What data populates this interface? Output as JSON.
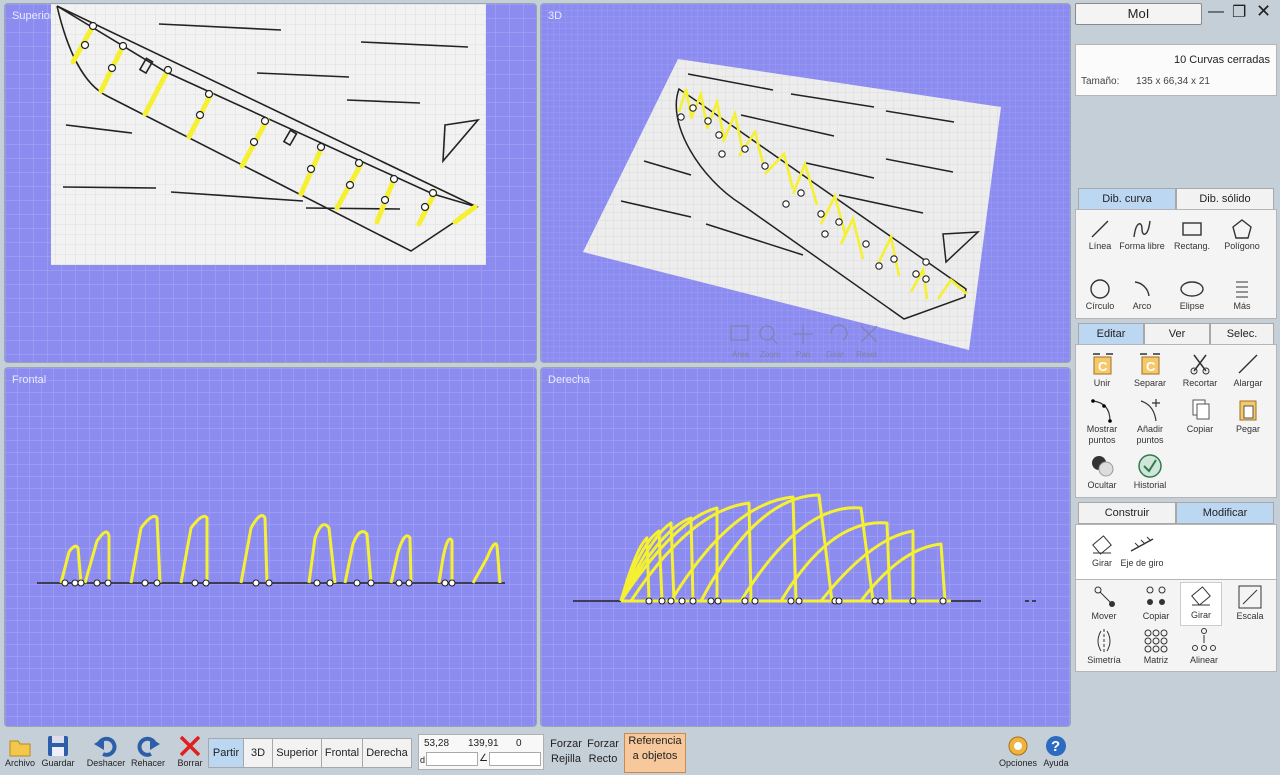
{
  "viewports": {
    "top": {
      "title": "Superior"
    },
    "perspective": {
      "title": "3D"
    },
    "front": {
      "title": "Frontal"
    },
    "right": {
      "title": "Derecha"
    }
  },
  "nav_tools": [
    "Área",
    "Zoom",
    "Pan",
    "Girar",
    "Reset"
  ],
  "app_title": "MoI",
  "properties": {
    "count": "10 Curvas cerradas",
    "size_label": "Tamaño:",
    "size_value": "135 x 66,34 x 21"
  },
  "draw_tabs": {
    "curve": "Dib. curva",
    "solid": "Dib. sólido"
  },
  "draw_tools": {
    "line": "Línea",
    "freeform": "Forma libre",
    "rect": "Rectang.",
    "polygon": "Polígono",
    "circle": "Círculo",
    "arc": "Arco",
    "ellipse": "Elipse",
    "more": "Más"
  },
  "edit_tabs": {
    "edit": "Editar",
    "view": "Ver",
    "select": "Selec."
  },
  "edit_tools": {
    "join": "Unir",
    "separate": "Separar",
    "trim": "Recortar",
    "extend": "Alargar",
    "show_points": "Mostrar puntos",
    "add_points": "Añadir puntos",
    "copy": "Copiar",
    "paste": "Pegar",
    "hide": "Ocultar",
    "history": "Historial"
  },
  "transform_tabs": {
    "construct": "Construir",
    "modify": "Modificar"
  },
  "rotate_sub": {
    "rotate": "Girar",
    "axis": "Eje de giro"
  },
  "transform_tools": {
    "move": "Mover",
    "copy": "Copiar",
    "rotate": "Girar",
    "scale": "Escala",
    "mirror": "Simetría",
    "array": "Matriz",
    "align": "Alinear"
  },
  "bottom": {
    "file": "Archivo",
    "save": "Guardar",
    "undo": "Deshacer",
    "redo": "Rehacer",
    "delete": "Borrar",
    "options": "Opciones",
    "help": "Ayuda"
  },
  "view_buttons": {
    "split": "Partir",
    "3d": "3D",
    "top": "Superior",
    "front": "Frontal",
    "right": "Derecha"
  },
  "coords": {
    "x": "53,28",
    "y": "139,91",
    "z": "0",
    "dist_label": "d",
    "angle_label": "∠"
  },
  "snap": {
    "grid_top": "Forzar",
    "grid_bottom": "Rejilla",
    "straight_top": "Forzar",
    "straight_bottom": "Recto",
    "objects_top": "Referencia",
    "objects_bottom": "a objetos"
  },
  "colors": {
    "viewport_bg": "#8c8cf0",
    "curve": "#f5f032",
    "paper": "#f0f0f0",
    "active_tab": "#bcd7f2",
    "snap_active": "#f7c89b"
  }
}
